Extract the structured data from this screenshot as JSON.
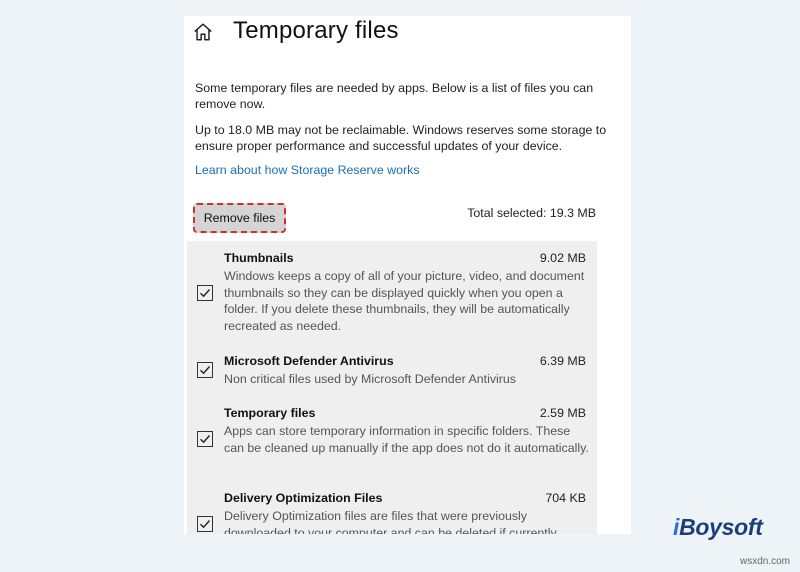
{
  "header": {
    "title": "Temporary files",
    "home_icon": "home-icon"
  },
  "intro": {
    "text1": "Some temporary files are needed by apps. Below is a list of files you can remove now.",
    "text2": "Up to 18.0 MB may not be reclaimable. Windows reserves some storage to ensure proper performance and successful updates of your device.",
    "link": "Learn about how Storage Reserve works"
  },
  "actions": {
    "remove_label": "Remove files",
    "total_selected": "Total selected: 19.3 MB"
  },
  "items": [
    {
      "name": "Thumbnails",
      "size": "9.02 MB",
      "checked": true,
      "desc": "Windows keeps a copy of all of your picture, video, and document thumbnails so they can be displayed quickly when you open a folder. If you delete these thumbnails, they will be automatically recreated as needed."
    },
    {
      "name": "Microsoft Defender Antivirus",
      "size": "6.39 MB",
      "checked": true,
      "desc": "Non critical files used by Microsoft Defender Antivirus"
    },
    {
      "name": "Temporary files",
      "size": "2.59 MB",
      "checked": true,
      "desc": "Apps can store temporary information in specific folders. These can be cleaned up manually if the app does not do it automatically."
    },
    {
      "name": "Delivery Optimization Files",
      "size": "704 KB",
      "checked": true,
      "desc": "Delivery Optimization files are files that were previously downloaded to your computer and can be deleted if currently unused by the Delivery Optimization service."
    }
  ],
  "branding": {
    "logo_prefix": "i",
    "logo_rest": "Boysoft",
    "watermark": "wsxdn.com"
  },
  "colors": {
    "link": "#1a6fb5",
    "button_border": "#d32c2c",
    "logo": "#1c3f7a"
  }
}
